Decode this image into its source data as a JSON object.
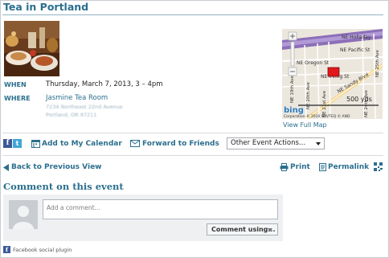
{
  "event": {
    "title": "Tea in Portland",
    "when_label": "WHEN",
    "when_value": "Thursday, March 7, 2013, 3 – 4pm",
    "where_label": "WHERE",
    "venue": "Jasmine Tea Room",
    "address_line1": "7234 Northeast 22nd Avenue",
    "address_line2": "Portland, OR 97211"
  },
  "map": {
    "streets": [
      "NE Holladay",
      "NE Pacific St",
      "NE Oregon St",
      "NE Irving St",
      "NE Sandy Blvd",
      "NE 19th Ave",
      "NE 20th Ave",
      "NE 21st Ave",
      "NE 24th Ave",
      "NE 25th Ave"
    ],
    "scale": "500 yds",
    "brand": "bing",
    "copyright": "Corporation © 2010 NAVTEQ © AND",
    "view_full_map": "View Full Map"
  },
  "actions": {
    "facebook_glyph": "f",
    "twitter_glyph": "t",
    "add_calendar": "Add to My Calendar",
    "forward": "Forward to Friends",
    "other_actions": "Other Event Actions..."
  },
  "nav": {
    "back": "Back to Previous View",
    "print": "Print",
    "permalink": "Permalink"
  },
  "comments": {
    "heading": "Comment on this event",
    "placeholder": "Add a comment...",
    "comment_using": "Comment using...",
    "plugin_label": "Facebook social plugin"
  },
  "colors": {
    "accent": "#2b6f8e",
    "facebook": "#3b5998",
    "twitter": "#3fa6d6",
    "map_marker": "#e0191b"
  }
}
